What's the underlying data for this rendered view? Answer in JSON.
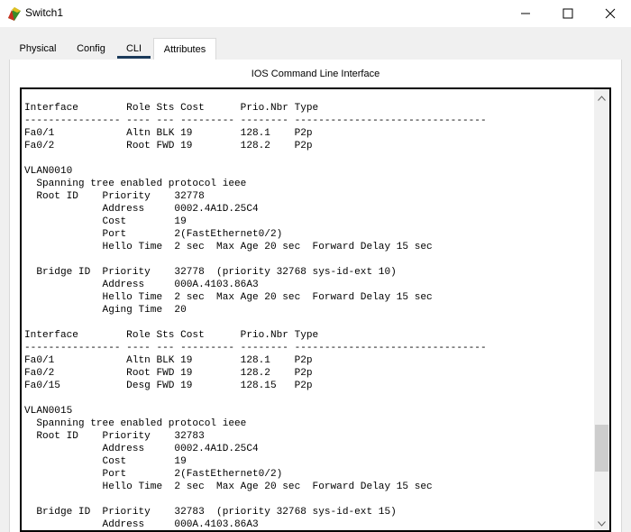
{
  "window": {
    "title": "Switch1",
    "icons": {
      "app": "router-app-icon",
      "minimize": "minimize-icon",
      "maximize": "maximize-icon",
      "close": "close-icon"
    }
  },
  "tabs": [
    {
      "label": "Physical",
      "active": false
    },
    {
      "label": "Config",
      "active": false
    },
    {
      "label": "CLI",
      "active": true
    },
    {
      "label": "Attributes",
      "active": false
    }
  ],
  "panel": {
    "title": "IOS Command Line Interface"
  },
  "console": {
    "lines": [
      "Interface        Role Sts Cost      Prio.Nbr Type",
      "---------------- ---- --- --------- -------- --------------------------------",
      "Fa0/1            Altn BLK 19        128.1    P2p",
      "Fa0/2            Root FWD 19        128.2    P2p",
      "",
      "VLAN0010",
      "  Spanning tree enabled protocol ieee",
      "  Root ID    Priority    32778",
      "             Address     0002.4A1D.25C4",
      "             Cost        19",
      "             Port        2(FastEthernet0/2)",
      "             Hello Time  2 sec  Max Age 20 sec  Forward Delay 15 sec",
      "",
      "  Bridge ID  Priority    32778  (priority 32768 sys-id-ext 10)",
      "             Address     000A.4103.86A3",
      "             Hello Time  2 sec  Max Age 20 sec  Forward Delay 15 sec",
      "             Aging Time  20",
      "",
      "Interface        Role Sts Cost      Prio.Nbr Type",
      "---------------- ---- --- --------- -------- --------------------------------",
      "Fa0/1            Altn BLK 19        128.1    P2p",
      "Fa0/2            Root FWD 19        128.2    P2p",
      "Fa0/15           Desg FWD 19        128.15   P2p",
      "",
      "VLAN0015",
      "  Spanning tree enabled protocol ieee",
      "  Root ID    Priority    32783",
      "             Address     0002.4A1D.25C4",
      "             Cost        19",
      "             Port        2(FastEthernet0/2)",
      "             Hello Time  2 sec  Max Age 20 sec  Forward Delay 15 sec",
      "",
      "  Bridge ID  Priority    32783  (priority 32768 sys-id-ext 15)",
      "             Address     000A.4103.86A3"
    ]
  },
  "scrollbar": {
    "position": 0.88,
    "icons": {
      "up": "chevron-up-icon",
      "down": "chevron-down-icon"
    }
  }
}
